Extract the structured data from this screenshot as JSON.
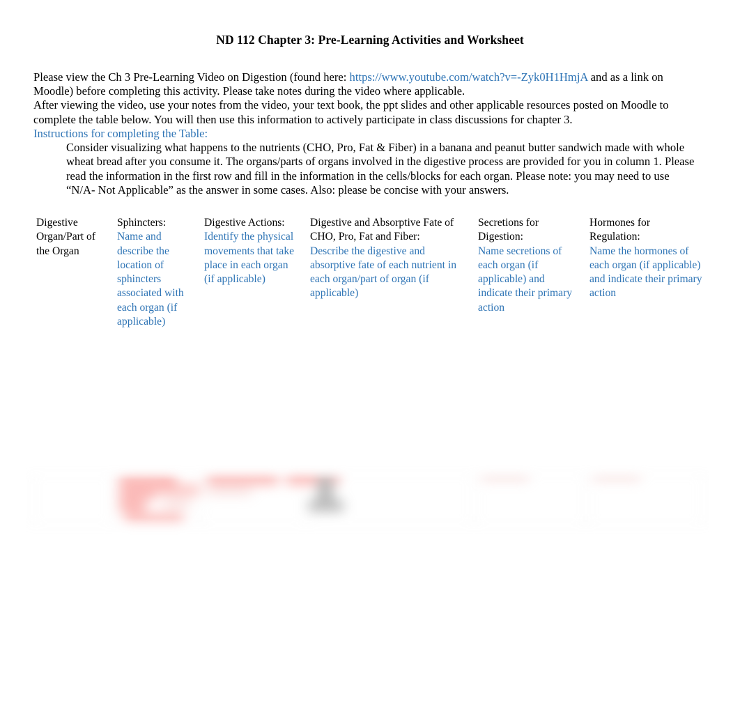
{
  "document": {
    "title": "ND 112 Chapter 3: Pre-Learning Activities and Worksheet"
  },
  "intro": {
    "para1_before_link": "Please view the Ch 3 Pre-Learning Video on Digestion (found here: ",
    "link_url_text": "https://www.youtube.com/watch?v=-Zyk0H1HmjA",
    "para1_after_link": " and as a link on Moodle) before completing this activity.  Please take notes during the video where applicable.",
    "para2": "After viewing the video, use your notes from the video, your text book, the ppt slides and other applicable resources posted on Moodle to complete the table below.  You will then use this information to actively participate in class discussions for chapter 3.",
    "instructions_heading": "Instructions for completing the Table:",
    "instructions_body": "Consider visualizing what happens to the nutrients (CHO, Pro, Fat & Fiber) in a banana and peanut butter sandwich made with whole wheat bread after you consume it.  The organs/parts of organs involved in the digestive process are provided for you in column 1.  Please read the information in the first row and fill in the information in the cells/blocks for each organ.  Please note: you may need to use “N/A- Not Applicable” as the answer in some cases.  Also: please be concise with your answers."
  },
  "table": {
    "columns": [
      {
        "heading": "Digestive Organ/Part of the Organ",
        "instruction": ""
      },
      {
        "heading": "Sphincters:",
        "instruction": "Name and describe the location of sphincters associated with each organ (if applicable)"
      },
      {
        "heading": "Digestive Actions:",
        "instruction": "Identify the physical movements that take place in each organ (if applicable)"
      },
      {
        "heading": "Digestive and Absorptive Fate of CHO, Pro, Fat and Fiber:",
        "instruction": "Describe the digestive and absorptive fate of each nutrient in each organ/part of organ (if applicable)"
      },
      {
        "heading": "Secretions for Digestion:",
        "instruction": "Name secretions of each organ (if applicable) and indicate their primary action"
      },
      {
        "heading": "Hormones for Regulation:",
        "instruction": "Name the hormones of each organ (if applicable)  and indicate their primary action"
      }
    ]
  },
  "colors": {
    "link_blue": "#2E74B5",
    "instruction_blue": "#2E74B5",
    "body_black": "#000000"
  }
}
